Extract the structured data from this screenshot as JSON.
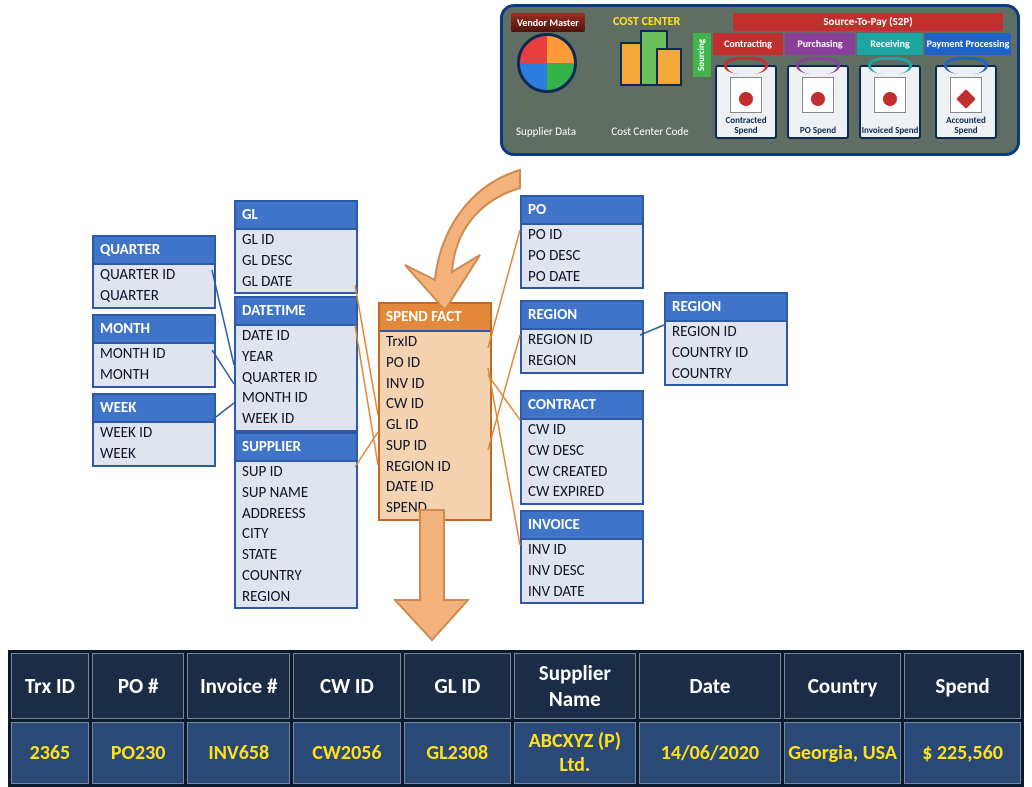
{
  "banner": {
    "vendor_master": "Vendor Master",
    "supplier_data": "Supplier Data",
    "cost_center_title": "COST CENTER",
    "cost_center_code": "Cost Center Code",
    "s2p": "Source-To-Pay (S2P)",
    "sourcing": "Sourcing",
    "steps": [
      "Contracting",
      "Purchasing",
      "Receiving",
      "Payment Processing"
    ],
    "cards": [
      "Contracted Spend",
      "PO Spend",
      "Invoiced Spend",
      "Accounted Spend"
    ]
  },
  "entities": {
    "quarter": {
      "header": "QUARTER",
      "rows": [
        "QUARTER ID",
        "QUARTER"
      ]
    },
    "month": {
      "header": "MONTH",
      "rows": [
        "MONTH ID",
        "MONTH"
      ]
    },
    "week": {
      "header": "WEEK",
      "rows": [
        "WEEK ID",
        "WEEK"
      ]
    },
    "gl": {
      "header": "GL",
      "rows": [
        "GL ID",
        "GL DESC",
        "GL DATE"
      ]
    },
    "datetime": {
      "header": "DATETIME",
      "rows": [
        "DATE ID",
        "YEAR",
        "QUARTER ID",
        "MONTH ID",
        "WEEK ID"
      ]
    },
    "supplier": {
      "header": "SUPPLIER",
      "rows": [
        "SUP ID",
        "SUP NAME",
        "ADDREESS",
        "CITY",
        "STATE",
        "COUNTRY",
        "REGION"
      ]
    },
    "fact": {
      "header": "SPEND FACT",
      "rows": [
        "TrxID",
        "PO ID",
        "INV ID",
        "CW ID",
        "GL ID",
        "SUP ID",
        "REGION ID",
        "DATE ID",
        "SPEND"
      ]
    },
    "po": {
      "header": "PO",
      "rows": [
        "PO ID",
        "PO DESC",
        "PO DATE"
      ]
    },
    "region": {
      "header": "REGION",
      "rows": [
        "REGION ID",
        "REGION"
      ]
    },
    "region2": {
      "header": "REGION",
      "rows": [
        "REGION ID",
        "COUNTRY ID",
        "COUNTRY"
      ]
    },
    "contract": {
      "header": "CONTRACT",
      "rows": [
        "CW ID",
        "CW DESC",
        "CW CREATED",
        "CW EXPIRED"
      ]
    },
    "invoice": {
      "header": "INVOICE",
      "rows": [
        "INV ID",
        "INV DESC",
        "INV DATE"
      ]
    }
  },
  "grid": {
    "headers": [
      "Trx ID",
      "PO #",
      "Invoice #",
      "CW ID",
      "GL ID",
      "Supplier Name",
      "Date",
      "Country",
      "Spend"
    ],
    "row": [
      "2365",
      "PO230",
      "INV658",
      "CW2056",
      "GL2308",
      "ABCXYZ (P) Ltd.",
      "14/06/2020",
      "Georgia, USA",
      "$ 225,560"
    ]
  }
}
